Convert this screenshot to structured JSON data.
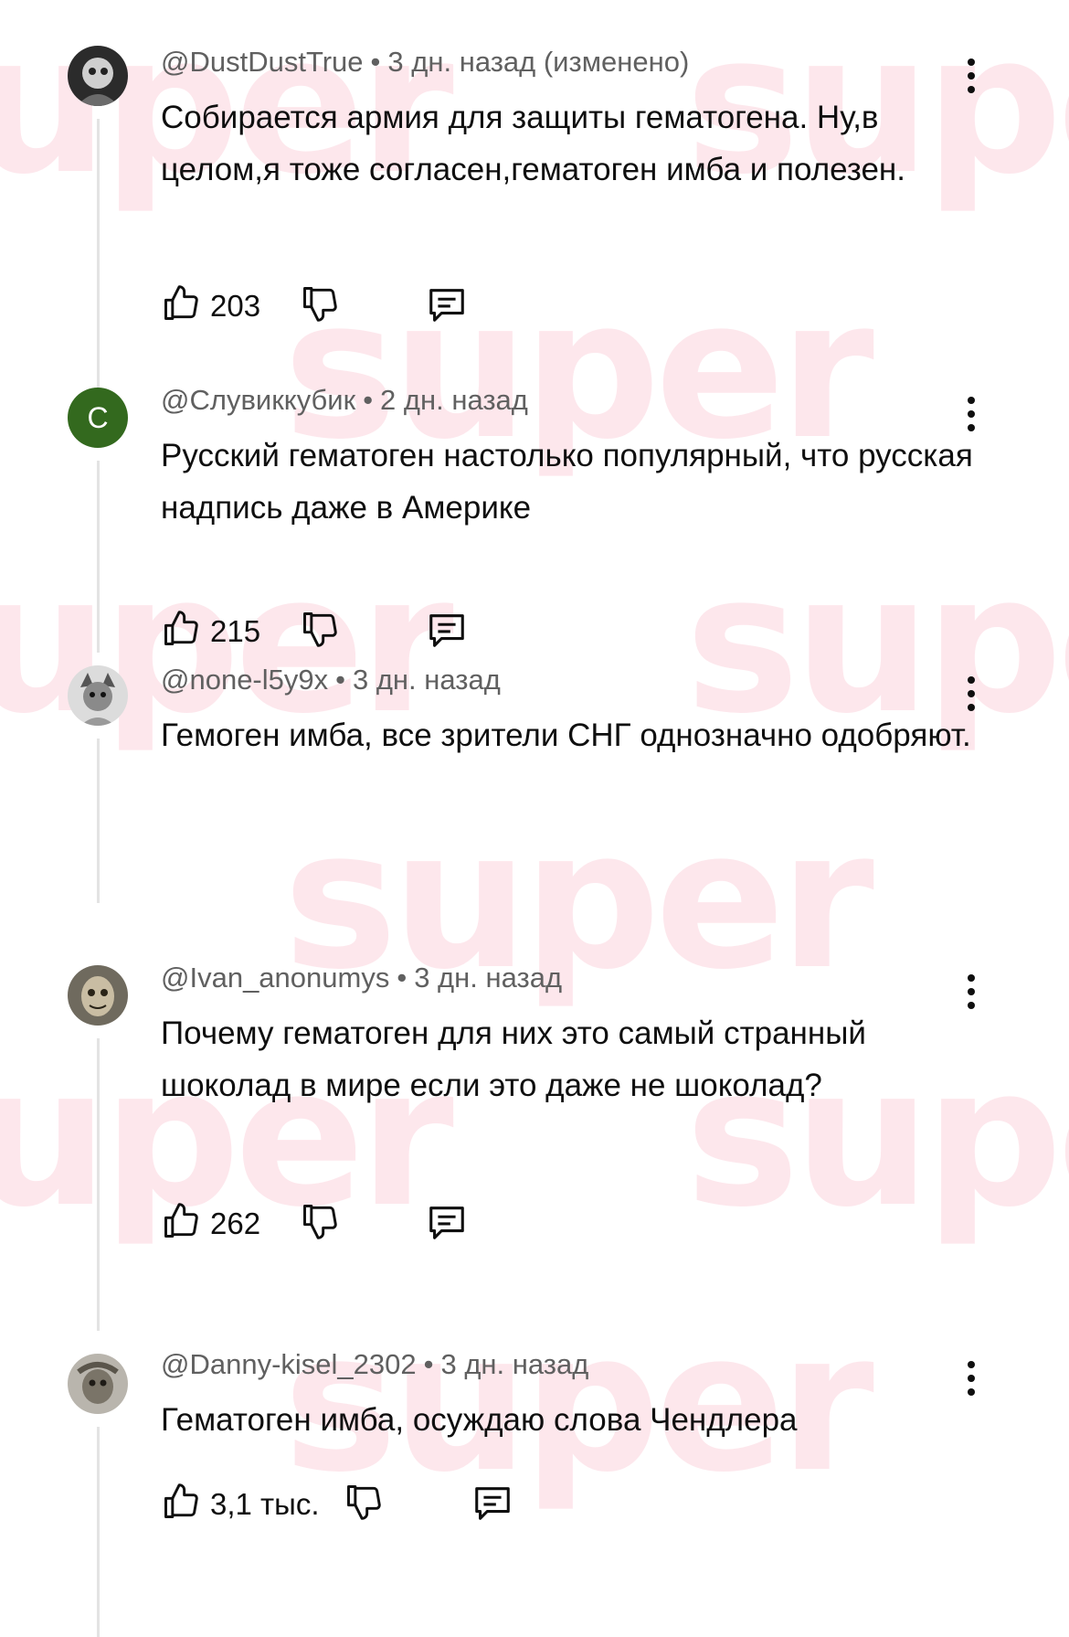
{
  "watermark": "super",
  "colors": {
    "meta_text": "#606060",
    "body_text": "#0f0f0f",
    "thread_line": "#e3e3e3",
    "avatar_letter_bg": "#33691e",
    "watermark": "#f8b4c4"
  },
  "icons": {
    "like": "thumbs-up-icon",
    "dislike": "thumbs-down-icon",
    "reply": "reply-comment-icon",
    "menu": "more-vert-icon"
  },
  "comments": [
    {
      "author": "@DustDustTrue",
      "time": "3 дн. назад (изменено)",
      "text": "Собирается армия для защиты гематогена. Ну,в целом,я тоже согласен,гематоген имба и полезен.",
      "likes": "203"
    },
    {
      "author": "@Слувиккубик",
      "avatar_letter": "С",
      "time": "2 дн. назад",
      "text": "Русский гематоген настолько популярный, что русская надпись даже в Америке",
      "likes": "215"
    },
    {
      "author": "@none-l5y9x",
      "time": "3 дн. назад",
      "text": "Гемоген имба, все зрители СНГ однозначно одобряют."
    },
    {
      "author": "@Ivan_anonumys",
      "time": "3 дн. назад",
      "text": "Почему гематоген для них это самый странный шоколад в мире если это даже не шоколад?",
      "likes": "262"
    },
    {
      "author": "@Danny-kisel_2302",
      "time": "3 дн. назад",
      "text": "Гематоген имба, осуждаю слова Чендлера",
      "likes": "3,1 тыс."
    }
  ]
}
